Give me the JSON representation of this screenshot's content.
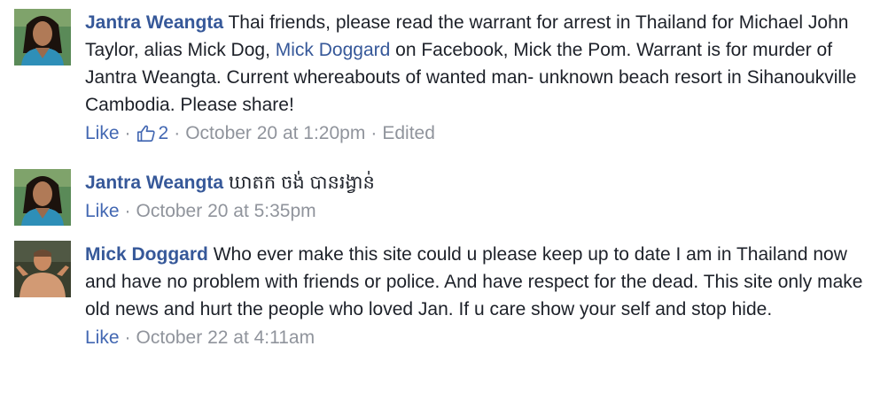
{
  "comments": [
    {
      "author": "Jantra Weangta",
      "text_before": "Thai friends, please read the warrant for arrest in Thailand for Michael John Taylor, alias Mick Dog,",
      "mention": "Mick Doggard",
      "text_after": "on Facebook, Mick the Pom. Warrant is for murder of Jantra Weangta. Current whereabouts of wanted man- unknown beach resort in Sihanoukville Cambodia. Please share!",
      "like_label": "Like",
      "like_count": "2",
      "timestamp": "October 20 at 1:20pm",
      "edited_label": "Edited"
    },
    {
      "author": "Jantra Weangta",
      "text": "ឃាតក ចង់ បានរង្វាន់",
      "like_label": "Like",
      "timestamp": "October 20 at 5:35pm"
    },
    {
      "author": "Mick Doggard",
      "text": "Who ever make this site could u please keep up to date I am in Thailand now and have no problem with friends or police. And have respect for the dead. This site only make old news and hurt the people who loved Jan. If u care show your self and stop hide.",
      "like_label": "Like",
      "timestamp": "October 22 at 4:11am"
    }
  ],
  "separator": "·",
  "icons": {
    "like_count": "thumbs-up-icon"
  },
  "colors": {
    "author_link": "#365899",
    "action_link": "#4267b2",
    "meta_gray": "#90949c",
    "body_text": "#1d2129"
  }
}
